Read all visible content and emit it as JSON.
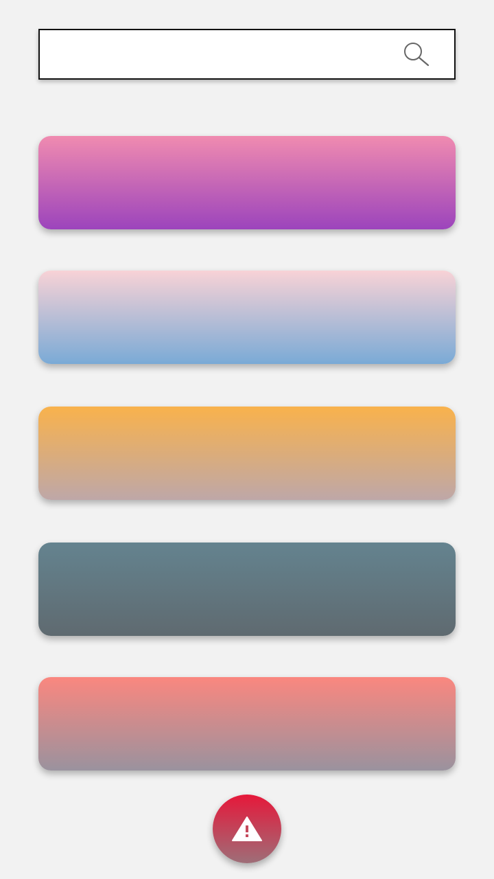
{
  "search": {
    "value": "",
    "placeholder": "",
    "icon": "search-icon",
    "icon_color": "#666666"
  },
  "cards": [
    {
      "name": "gradient-card-pink-purple",
      "colors": [
        "#f08bb0",
        "#9c44bc"
      ]
    },
    {
      "name": "gradient-card-pink-blue",
      "colors": [
        "#f8d2d6",
        "#7aaad6"
      ]
    },
    {
      "name": "gradient-card-orange-mauve",
      "colors": [
        "#f9b24c",
        "#bea7a8"
      ]
    },
    {
      "name": "gradient-card-slate",
      "colors": [
        "#64838f",
        "#5f6a70"
      ]
    },
    {
      "name": "gradient-card-coral-grey",
      "colors": [
        "#fa877f",
        "#9a929e"
      ]
    }
  ],
  "fab": {
    "icon": "warning-icon",
    "colors": [
      "#e6183a",
      "#9e6e78"
    ],
    "icon_color": "#ffffff"
  }
}
